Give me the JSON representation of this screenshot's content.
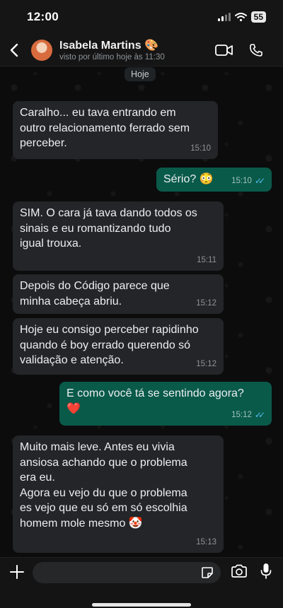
{
  "status_bar": {
    "time": "12:00",
    "battery": "55"
  },
  "header": {
    "name": "Isabela Martins",
    "name_emoji": "🎨",
    "status": "visto por último hoje às 11:30",
    "icons": [
      "back-arrow-icon",
      "video-call-icon",
      "phone-icon"
    ]
  },
  "chat": {
    "date_label": "Hoje",
    "messages": [
      {
        "direction": "incoming",
        "text": "Caralho... eu tava entrando em\noutro relacionamento ferrado sem\nperceber.",
        "time": "15:10"
      },
      {
        "direction": "outgoing",
        "text": "Sério? 😳",
        "time": "15:10",
        "read": true
      },
      {
        "direction": "incoming",
        "text": "SIM. O cara já tava dando todos os\nsinais e eu romantizando tudo\nigual trouxa.",
        "time": "15:11"
      },
      {
        "direction": "incoming",
        "text": "Depois do Código parece que\nminha cabeça abriu.",
        "time": "15:12"
      },
      {
        "direction": "incoming",
        "text": "Hoje eu consigo perceber rapidinho\nquando é boy errado querendo só\nvalidação e atenção.",
        "time": "15:12"
      },
      {
        "direction": "outgoing",
        "text": "E como você tá se sentindo agora?\n❤️",
        "time": "15:12",
        "read": true
      },
      {
        "direction": "incoming",
        "text": "Muito mais leve. Antes eu vivia\nansiosa achando que o problema\nera eu.\nAgora eu vejo du que o problema\nes vejo que eu só em só escolhia\nhomem mole mesmo 🤡",
        "time": "15:13"
      }
    ]
  },
  "composer": {
    "placeholder": "",
    "icons": [
      "plus-icon",
      "sticker-icon",
      "camera-icon",
      "microphone-icon"
    ]
  },
  "colors": {
    "incoming_bubble": "#232528",
    "outgoing_bubble": "#0a5a4a",
    "read_ticks": "#53bdeb",
    "background": "#0c0c0c"
  }
}
